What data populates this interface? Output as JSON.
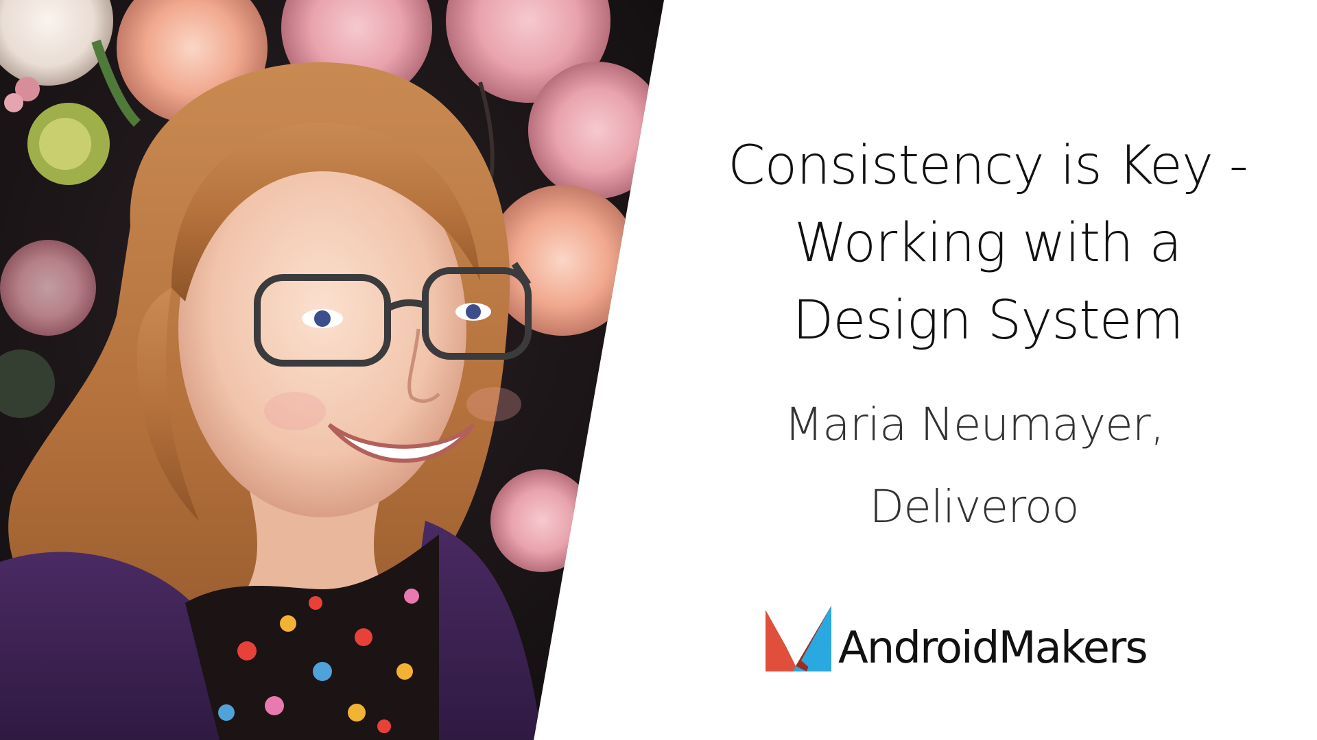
{
  "slide": {
    "title_lines": [
      "Consistency is Key -",
      "Working with a",
      "Design System"
    ],
    "speaker_lines": [
      "Maria Neumayer,",
      "Deliveroo"
    ]
  },
  "logo": {
    "text": "AndroidMakers",
    "icon": "android-makers-logo-icon"
  },
  "photo": {
    "icon": "speaker-photo"
  },
  "colors": {
    "background": "#ffffff",
    "title_text": "#111111",
    "speaker_text": "#333333",
    "logo_red": "#e04e3c",
    "logo_blue": "#29a9e0",
    "logo_dark_red": "#9e2a22"
  }
}
